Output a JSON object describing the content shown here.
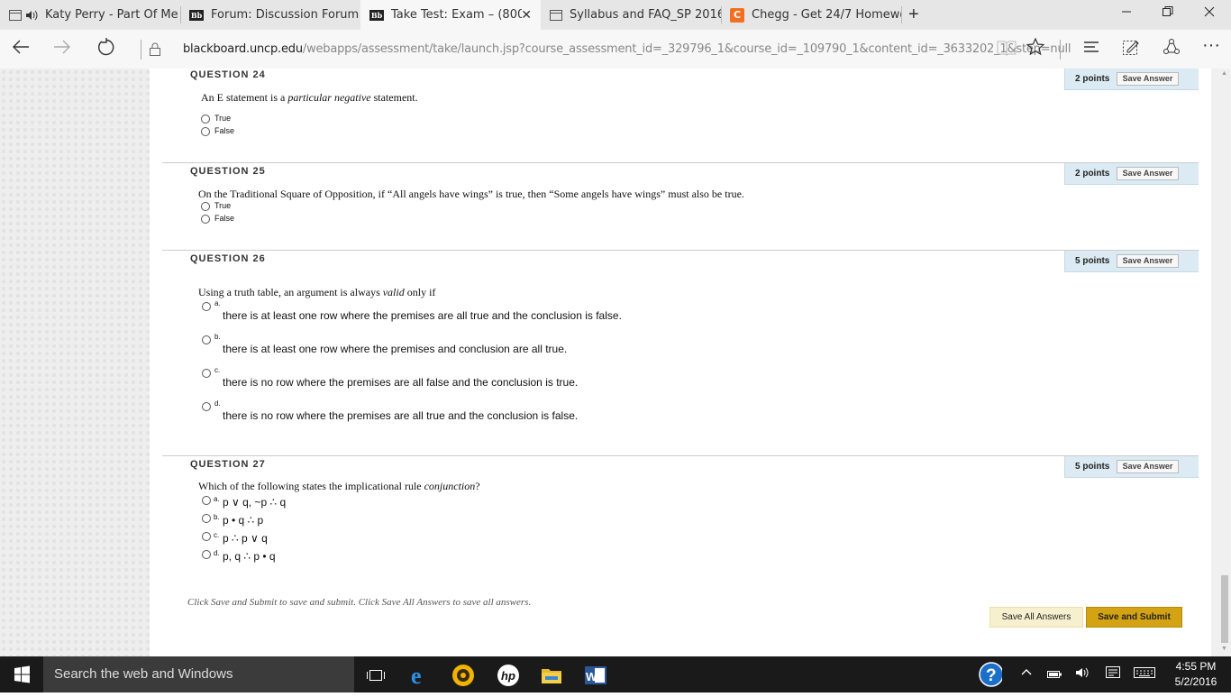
{
  "browser": {
    "tabs": [
      {
        "title": "Katy Perry - Part Of Me ·",
        "icon": "speaker-icon",
        "active": false
      },
      {
        "title": "Forum: Discussion Forum –",
        "icon": "blackboard-icon",
        "active": false
      },
      {
        "title": "Take Test: Exam – (800,8",
        "icon": "blackboard-icon",
        "active": true
      },
      {
        "title": "Syllabus and FAQ_SP 2016(1",
        "icon": "page-icon",
        "active": false
      },
      {
        "title": "Chegg - Get 24/7 Homewor",
        "icon": "chegg-icon",
        "active": false
      }
    ],
    "bb_icon_text": "Bb",
    "chegg_icon_text": "C",
    "url_domain": "blackboard.uncp.edu",
    "url_prefix": "",
    "url_path": "/webapps/assessment/take/launch.jsp?course_assessment_id=_329796_1&course_id=_109790_1&content_id=_3633202_1&step=null"
  },
  "questions": [
    {
      "heading": "QUESTION 24",
      "points": "2 points",
      "save_label": "Save Answer",
      "text_before": "An E statement is a ",
      "text_em": "particular negative",
      "text_after": " statement.",
      "options": [
        "True",
        "False"
      ]
    },
    {
      "heading": "QUESTION 25",
      "points": "2 points",
      "save_label": "Save Answer",
      "text": "On the Traditional Square of Opposition, if “All angels have wings” is true, then “Some angels have wings” must also be true.",
      "options": [
        "True",
        "False"
      ]
    },
    {
      "heading": "QUESTION 26",
      "points": "5 points",
      "save_label": "Save Answer",
      "text_before": "Using a truth table, an argument is always ",
      "text_em": "valid",
      "text_after": " only if",
      "options": [
        {
          "letter": "a.",
          "text": "there is at least one row where the premises are all true and the conclusion is false."
        },
        {
          "letter": "b.",
          "text": "there is at least one row where the premises and conclusion are all true."
        },
        {
          "letter": "c.",
          "text": "there is no row where the premises are all false and the conclusion is true."
        },
        {
          "letter": "d.",
          "text": "there is no row where the premises are all true and the conclusion is false."
        }
      ]
    },
    {
      "heading": "QUESTION 27",
      "points": "5 points",
      "save_label": "Save Answer",
      "text_before": "Which of the following states the implicational rule ",
      "text_em": "conjunction",
      "text_after": "?",
      "options": [
        {
          "letter": "a.",
          "text": "p ∨ q, ~p ∴ q"
        },
        {
          "letter": "b.",
          "text": "p • q ∴ p"
        },
        {
          "letter": "c.",
          "text": "p ∴ p ∨ q"
        },
        {
          "letter": "d.",
          "text": "p, q ∴ p • q"
        }
      ]
    }
  ],
  "footer": {
    "note": "Click Save and Submit to save and submit. Click Save All Answers to save all answers.",
    "save_all_label": "Save All Answers",
    "save_submit_label": "Save and Submit"
  },
  "taskbar": {
    "search_placeholder": "Search the web and Windows",
    "time": "4:55 PM",
    "date": "5/2/2016"
  }
}
